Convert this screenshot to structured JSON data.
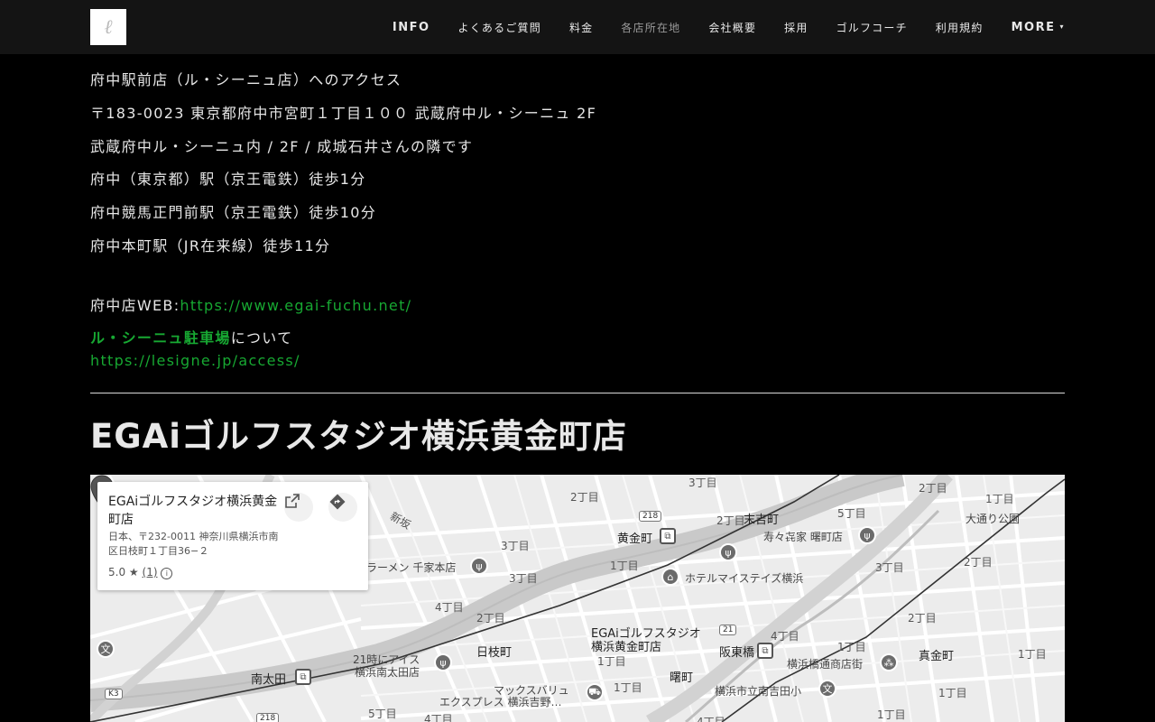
{
  "header": {
    "logo_glyph": "ℓ",
    "nav": [
      {
        "label": "INFO",
        "lang": "en"
      },
      {
        "label": "よくあるご質問",
        "lang": "ja"
      },
      {
        "label": "料金",
        "lang": "ja"
      },
      {
        "label": "各店所在地",
        "lang": "ja",
        "active": true
      },
      {
        "label": "会社概要",
        "lang": "ja"
      },
      {
        "label": "採用",
        "lang": "ja"
      },
      {
        "label": "ゴルフコーチ",
        "lang": "ja"
      },
      {
        "label": "利用規約",
        "lang": "ja"
      },
      {
        "label": "MORE",
        "lang": "en"
      }
    ],
    "more_caret": "▾"
  },
  "access": {
    "heading": "府中駅前店（ル・シーニュ店）へのアクセス",
    "address": "〒183-0023 東京都府中市宮町１丁目１００ 武蔵府中ル・シーニュ 2F",
    "building": "武蔵府中ル・シーニュ内 / 2F / 成城石井さんの隣です",
    "route1": "府中（東京都）駅（京王電鉄）徒歩1分",
    "route2": "府中競馬正門前駅（京王電鉄）徒歩10分",
    "route3": "府中本町駅（JR在来線）徒歩11分",
    "web_label": "府中店WEB:",
    "web_url": "https://www.egai-fuchu.net/",
    "parking_link": "ル・シーニュ駐車場",
    "parking_suffix": "について",
    "parking_url": "https://lesigne.jp/access/"
  },
  "store": {
    "title": "EGAiゴルフスタジオ横浜黄金町店"
  },
  "map": {
    "card": {
      "name": "EGAiゴルフスタジオ横浜黄金町店",
      "address": "日本、〒232-0011 神奈川県横浜市南区日枝町１丁目36−２",
      "rating": "5.0",
      "rating_count": "(1)",
      "open_icon": "open-in-new-icon",
      "directions_icon": "directions-icon"
    },
    "pin_label_1": "EGAiゴルフスタジオ",
    "pin_label_2": "横浜黄金町店",
    "labels": {
      "koganecho": "黄金町",
      "suehirocho": "末吉町",
      "sushi": "寿々㐂家 曙町店",
      "ramen": "ラーメン 千家本店",
      "hotel": "ホテルマイステイズ横浜",
      "hiecho": "日枝町",
      "minamiota": "南太田",
      "ice1": "21時にアイス",
      "ice2": "横浜南太田店",
      "maxvalu1": "マックスバリュ",
      "maxvalu2": "エクスプレス 横浜吉野…",
      "akebonocho": "曙町",
      "hantobashi": "阪東橋",
      "shotengai": "横浜橋通商店街",
      "school": "横浜市立南吉田小",
      "magane": "真金町",
      "odori": "大通り公園",
      "shinsaka": "新坂",
      "r218": "218",
      "r21": "21",
      "k3": "K3",
      "c1": "1丁目",
      "c2": "2丁目",
      "c3": "3丁目",
      "c4": "4丁目",
      "c5": "5丁目"
    }
  }
}
